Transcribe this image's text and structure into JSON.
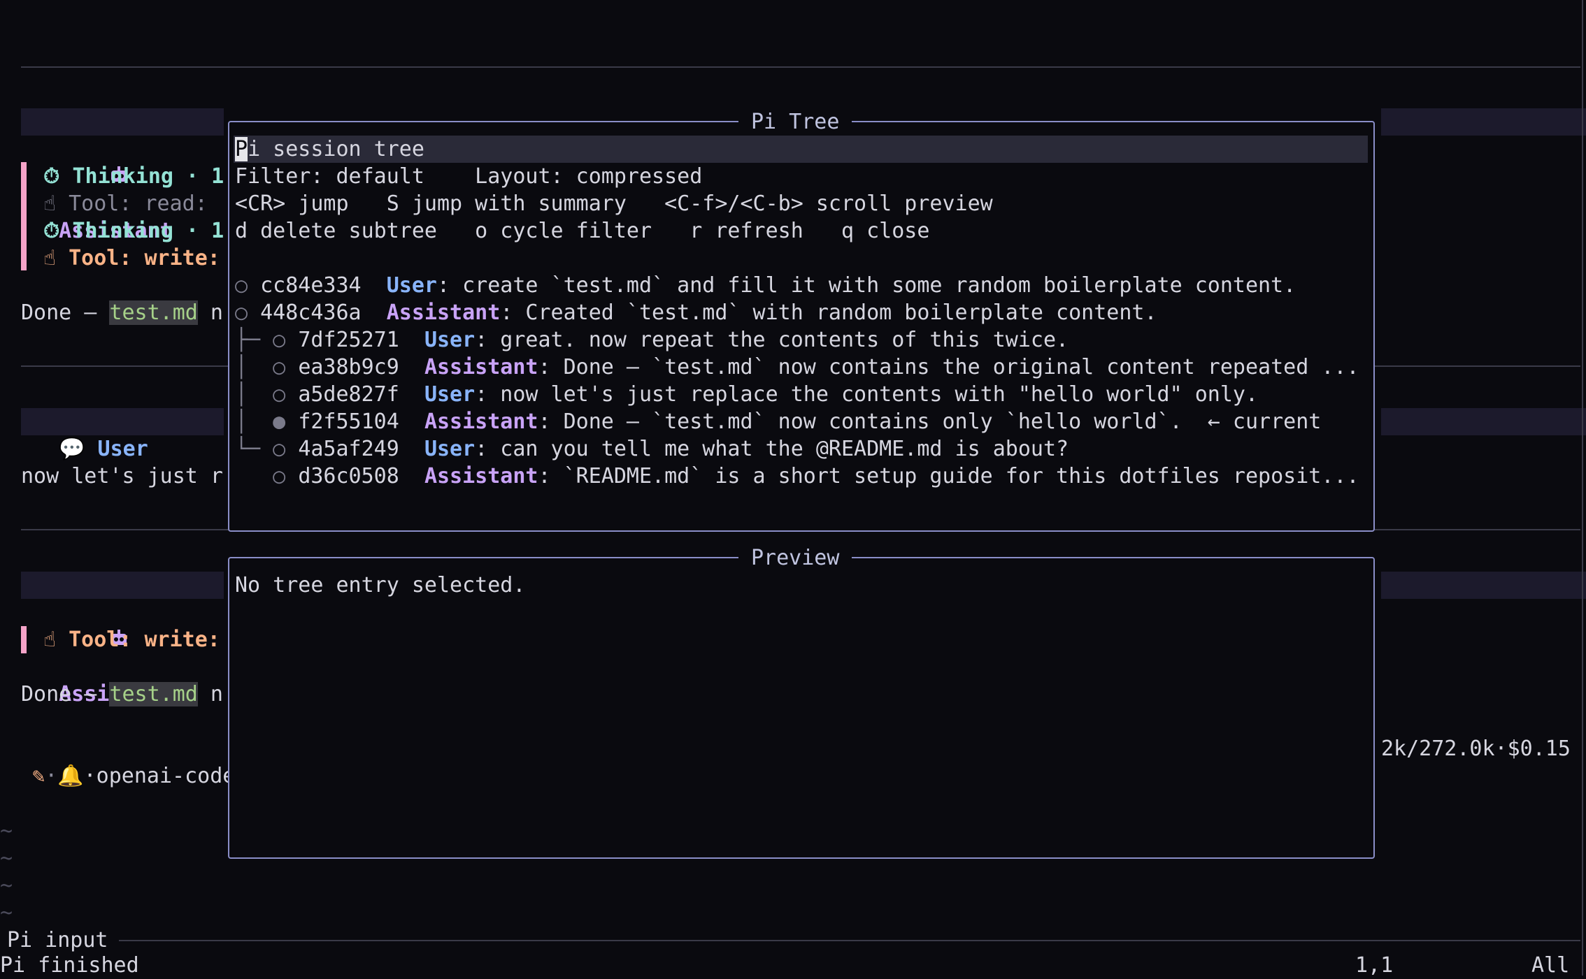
{
  "background": {
    "block1": {
      "header": "Assistant",
      "thinking1": "Thinking · 1",
      "tool_read": "Tool: read:",
      "thinking2": "Thinking · 1",
      "tool_write": "Tool: write:",
      "done_prefix": "Done — ",
      "done_file": "test.md",
      "done_suffix": " n"
    },
    "block2": {
      "header": "User",
      "text": "now let's just r"
    },
    "block3": {
      "header": "Assistant",
      "tool_write": "Tool: write:",
      "done_prefix": "Done — ",
      "done_file": "test.md",
      "done_suffix": " n"
    },
    "statusline": {
      "left": "·openai-code",
      "right": "2k/272.0k·$0.15"
    },
    "input_label": "Pi input",
    "status_left": "Pi finished",
    "status_pos": "1,1",
    "status_all": "All"
  },
  "tree_panel": {
    "title": "Pi Tree",
    "header_line_cursor": "P",
    "header_line_rest": "i session tree",
    "filter_line": "Filter: default    Layout: compressed",
    "help1": "<CR> jump   S jump with summary   <C-f>/<C-b> scroll preview",
    "help2": "d delete subtree   o cycle filter   r refresh   q close",
    "entries": [
      {
        "prefix": "○ ",
        "id": "cc84e334",
        "role": "User",
        "text": ": create `test.md` and fill it with some random boilerplate content."
      },
      {
        "prefix": "○ ",
        "id": "448c436a",
        "role": "Assistant",
        "text": ": Created `test.md` with random boilerplate content."
      },
      {
        "prefix": "├─ ○ ",
        "id": "7df25271",
        "role": "User",
        "text": ": great. now repeat the contents of this twice."
      },
      {
        "prefix": "│  ○ ",
        "id": "ea38b9c9",
        "role": "Assistant",
        "text": ": Done — `test.md` now contains the original content repeated ..."
      },
      {
        "prefix": "│  ○ ",
        "id": "a5de827f",
        "role": "User",
        "text": ": now let's just replace the contents with \"hello world\" only."
      },
      {
        "prefix": "│  ● ",
        "id": "f2f55104",
        "role": "Assistant",
        "text": ": Done — `test.md` now contains only `hello world`.  ← current"
      },
      {
        "prefix": "└─ ○ ",
        "id": "4a5af249",
        "role": "User",
        "text": ": can you tell me what the @README.md is about?"
      },
      {
        "prefix": "   ○ ",
        "id": "d36c0508",
        "role": "Assistant",
        "text": ": `README.md` is a short setup guide for this dotfiles reposit..."
      }
    ]
  },
  "preview_panel": {
    "title": "Preview",
    "text": "No tree entry selected."
  },
  "colors": {
    "accent_border": "#8a8ec8",
    "assistant": "#c9a3f7",
    "user": "#89b4fa",
    "thinking": "#94e2d5",
    "tool_write": "#fab387",
    "bar": "#f5a3c8"
  }
}
